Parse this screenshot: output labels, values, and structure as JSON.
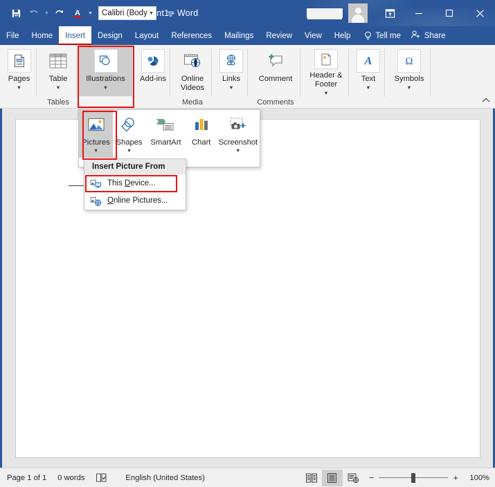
{
  "titlebar": {
    "quick_access": [
      {
        "name": "save-icon",
        "label": "Save"
      },
      {
        "name": "undo-icon",
        "label": "Undo"
      },
      {
        "name": "redo-icon",
        "label": "Redo"
      },
      {
        "name": "font-color-icon",
        "label": "Font Color"
      }
    ],
    "font_name": "Calibri (Body",
    "customize_label": "Customize Quick Access Toolbar",
    "document_title": "Document1  -  Word",
    "user_name_redacted": "",
    "ribbon_display_label": "Ribbon Display Options",
    "minimize_label": "Minimize",
    "restore_label": "Restore Down",
    "close_label": "Close"
  },
  "tabs": [
    {
      "label": "File",
      "active": false
    },
    {
      "label": "Home",
      "active": false
    },
    {
      "label": "Insert",
      "active": true
    },
    {
      "label": "Design",
      "active": false
    },
    {
      "label": "Layout",
      "active": false
    },
    {
      "label": "References",
      "active": false
    },
    {
      "label": "Mailings",
      "active": false
    },
    {
      "label": "Review",
      "active": false
    },
    {
      "label": "View",
      "active": false
    },
    {
      "label": "Help",
      "active": false
    }
  ],
  "tellme": {
    "label": "Tell me",
    "icon": "lightbulb-icon"
  },
  "share": {
    "label": "Share",
    "icon": "share-person-icon"
  },
  "ribbon": {
    "groups": [
      {
        "name": "pages",
        "button": "Pages",
        "group_label": "",
        "caret": true,
        "icon": "pages-icon",
        "selected": false
      },
      {
        "name": "table",
        "button": "Table",
        "group_label": "Tables",
        "caret": true,
        "icon": "table-icon",
        "selected": false
      },
      {
        "name": "illustrations",
        "button": "Illustrations",
        "group_label": "",
        "caret": true,
        "icon": "illustrations-icon",
        "selected": true
      },
      {
        "name": "add-ins",
        "button": "Add-ins",
        "group_label": "",
        "caret": true,
        "icon": "addins-icon",
        "selected": false
      },
      {
        "name": "online-videos",
        "button": "Online Videos",
        "group_label": "Media",
        "caret": false,
        "icon": "online-video-icon",
        "selected": false
      },
      {
        "name": "links",
        "button": "Links",
        "group_label": "",
        "caret": true,
        "icon": "links-icon",
        "selected": false
      },
      {
        "name": "comment",
        "button": "Comment",
        "group_label": "Comments",
        "caret": false,
        "icon": "comment-icon",
        "selected": false
      },
      {
        "name": "header-footer",
        "button": "Header & Footer",
        "group_label": "",
        "caret": true,
        "icon": "header-footer-icon",
        "selected": false
      },
      {
        "name": "text",
        "button": "Text",
        "group_label": "",
        "caret": true,
        "icon": "text-icon",
        "selected": false
      },
      {
        "name": "symbols",
        "button": "Symbols",
        "group_label": "",
        "caret": true,
        "icon": "symbols-icon",
        "selected": false
      }
    ],
    "collapse_label": "Collapse the Ribbon"
  },
  "illustrations_panel": {
    "items": [
      {
        "label": "Pictures",
        "icon": "pictures-icon",
        "caret": true,
        "selected": true
      },
      {
        "label": "Shapes",
        "icon": "shapes-icon",
        "caret": true,
        "selected": false
      },
      {
        "label": "SmartArt",
        "icon": "smartart-icon",
        "caret": false,
        "selected": false
      },
      {
        "label": "Chart",
        "icon": "chart-icon",
        "caret": false,
        "selected": false
      },
      {
        "label": "Screenshot",
        "icon": "screenshot-icon",
        "caret": true,
        "selected": false
      }
    ]
  },
  "picture_menu": {
    "header": "Insert Picture From",
    "items": [
      {
        "label": "This Device...",
        "accel": "D",
        "icon": "this-device-icon",
        "highlighted": true
      },
      {
        "label": "Online Pictures...",
        "accel": "O",
        "icon": "online-pictures-icon",
        "highlighted": false
      }
    ]
  },
  "statusbar": {
    "page": "Page 1 of 1",
    "words": "0 words",
    "proofing_icon": "proofing-errors-icon",
    "language": "English (United States)",
    "views": [
      {
        "name": "read-mode",
        "label": "Read Mode",
        "selected": false
      },
      {
        "name": "print-layout",
        "label": "Print Layout",
        "selected": true
      },
      {
        "name": "web-layout",
        "label": "Web Layout",
        "selected": false
      }
    ],
    "zoom_out": "−",
    "zoom_in": "+",
    "zoom_level": "100%"
  },
  "colors": {
    "word_blue": "#2b579a",
    "accent_red": "#c00000",
    "annotation_red": "#ee1111",
    "ribbon_bg": "#f3f3f3",
    "selected_gray": "#cdcdcd"
  }
}
